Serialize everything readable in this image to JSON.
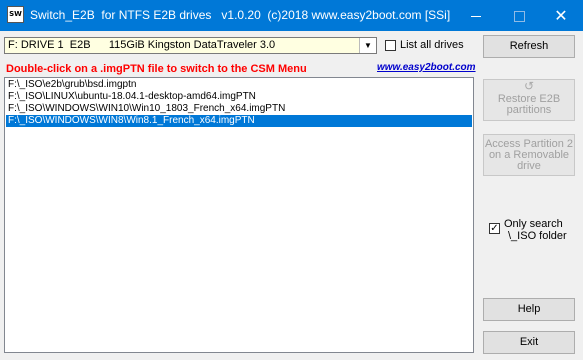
{
  "window": {
    "title": "Switch_E2B  for NTFS E2B drives   v1.0.20  (c)2018 www.easy2boot.com [SSi]",
    "app_icon_text": "SW",
    "minimize_icon": "minimize-icon",
    "maximize_icon": "maximize-icon",
    "close_icon": "close-icon"
  },
  "drive_select": {
    "value": "F: DRIVE 1  E2B      115GiB Kingston DataTraveler 3.0"
  },
  "list_all_drives": {
    "label": "List all drives",
    "checked": false
  },
  "instruction": "Double-click on a .imgPTN file to switch to the CSM Menu",
  "site_link": "www.easy2boot.com",
  "files": [
    {
      "path": "F:\\_ISO\\e2b\\grub\\bsd.imgptn",
      "selected": false
    },
    {
      "path": "F:\\_ISO\\LINUX\\ubuntu-18.04.1-desktop-amd64.imgPTN",
      "selected": false
    },
    {
      "path": "F:\\_ISO\\WINDOWS\\WIN10\\Win10_1803_French_x64.imgPTN",
      "selected": false
    },
    {
      "path": "F:\\_ISO\\WINDOWS\\WIN8\\Win8.1_French_x64.imgPTN",
      "selected": true
    }
  ],
  "buttons": {
    "refresh": "Refresh",
    "restore_line1": "Restore E2B",
    "restore_line2": "partitions",
    "access_line1": "Access Partition 2",
    "access_line2": "on a Removable",
    "access_line3": "drive",
    "help": "Help",
    "exit": "Exit"
  },
  "only_search": {
    "line1": "Only search",
    "line2": "\\_ISO folder",
    "checked": true
  },
  "colors": {
    "titlebar": "#0078d7",
    "selection": "#0078d7",
    "instruction": "#ff0000",
    "link": "#0000cc",
    "drive_bg": "#ffffe1"
  }
}
